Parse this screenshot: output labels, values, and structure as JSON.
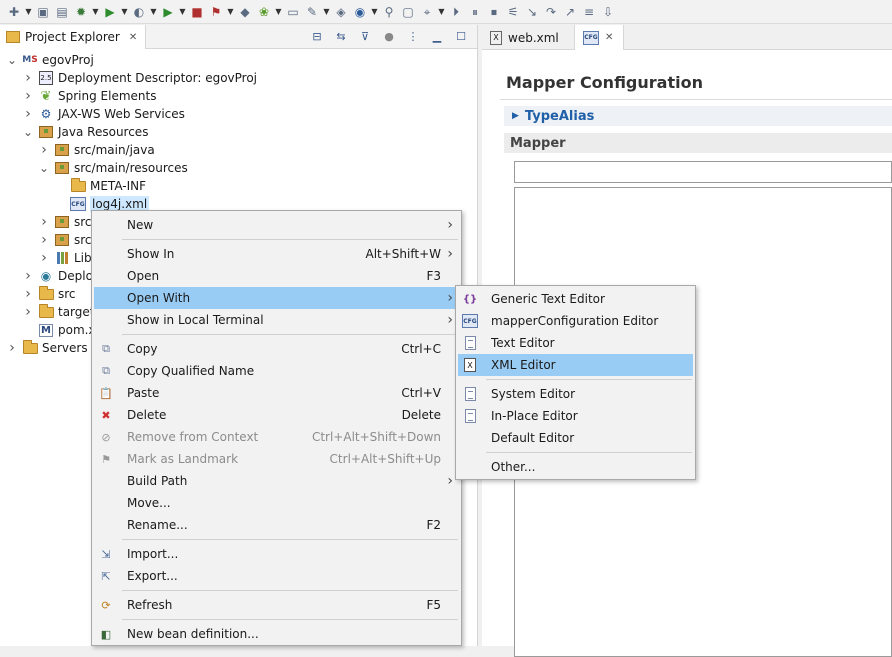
{
  "toolbar": {
    "icons": [
      "new-icon",
      "save-icon",
      "save-all-icon",
      "debug-icon",
      "run-icon",
      "coverage-icon",
      "run-server-icon",
      "stop-icon",
      "profile-icon",
      "new-java-icon",
      "new-spring-icon",
      "open-folder-icon",
      "open-task-icon",
      "open-type-icon",
      "globe-icon",
      "search-icon",
      "console-icon",
      "pin-icon",
      "resume-icon",
      "suspend-icon",
      "terminate-icon",
      "disconnect-icon",
      "step-into-icon",
      "step-over-icon",
      "step-return-icon",
      "drop-frame-icon",
      "next-annotation-icon"
    ]
  },
  "explorer": {
    "tab_label": "Project Explorer",
    "tree": [
      {
        "label": "egovProj",
        "indent": 0,
        "twisty": "open",
        "icon": "maven-project-icon"
      },
      {
        "label": "Deployment Descriptor: egovProj",
        "indent": 1,
        "twisty": "closed",
        "icon": "deployment-descriptor-icon"
      },
      {
        "label": "Spring Elements",
        "indent": 1,
        "twisty": "closed",
        "icon": "spring-leaf-icon"
      },
      {
        "label": "JAX-WS Web Services",
        "indent": 1,
        "twisty": "closed",
        "icon": "web-services-icon"
      },
      {
        "label": "Java Resources",
        "indent": 1,
        "twisty": "open",
        "icon": "java-resources-icon"
      },
      {
        "label": "src/main/java",
        "indent": 2,
        "twisty": "closed",
        "icon": "source-folder-icon"
      },
      {
        "label": "src/main/resources",
        "indent": 2,
        "twisty": "open",
        "icon": "source-folder-icon"
      },
      {
        "label": "META-INF",
        "indent": 3,
        "twisty": "none",
        "icon": "folder-icon"
      },
      {
        "label": "log4j.xml",
        "indent": 3,
        "twisty": "none",
        "icon": "cfg-file-icon",
        "selected": true
      },
      {
        "label": "src/",
        "indent": 2,
        "twisty": "closed",
        "icon": "source-folder-icon"
      },
      {
        "label": "src/",
        "indent": 2,
        "twisty": "closed",
        "icon": "source-folder-icon"
      },
      {
        "label": "Libr",
        "indent": 2,
        "twisty": "closed",
        "icon": "library-icon"
      },
      {
        "label": "Deplo",
        "indent": 1,
        "twisty": "closed",
        "icon": "deployed-resources-icon"
      },
      {
        "label": "src",
        "indent": 1,
        "twisty": "closed",
        "icon": "folder-icon"
      },
      {
        "label": "target",
        "indent": 1,
        "twisty": "closed",
        "icon": "folder-icon"
      },
      {
        "label": "pom.x",
        "indent": 1,
        "twisty": "none",
        "icon": "maven-pom-icon"
      },
      {
        "label": "Servers",
        "indent": 0,
        "twisty": "closed",
        "icon": "folder-icon"
      }
    ]
  },
  "editor": {
    "tabs": [
      {
        "label": "web.xml",
        "icon": "xml-file-icon"
      },
      {
        "label": "",
        "icon": "cfg-file-icon"
      }
    ],
    "form_title": "Mapper Configuration",
    "section_typealias": "TypeAlias",
    "section_mapper": "Mapper"
  },
  "context_menu": {
    "items": [
      {
        "label": "New",
        "shortcut": "",
        "submenu": true,
        "icon": "",
        "disabled": false
      },
      {
        "sep": true
      },
      {
        "label": "Show In",
        "shortcut": "Alt+Shift+W",
        "submenu": true,
        "icon": "",
        "disabled": false
      },
      {
        "label": "Open",
        "shortcut": "F3",
        "submenu": false,
        "icon": "",
        "disabled": false
      },
      {
        "label": "Open With",
        "shortcut": "",
        "submenu": true,
        "icon": "",
        "disabled": false,
        "highlighted": true
      },
      {
        "label": "Show in Local Terminal",
        "shortcut": "",
        "submenu": true,
        "icon": "",
        "disabled": false
      },
      {
        "sep": true
      },
      {
        "label": "Copy",
        "shortcut": "Ctrl+C",
        "submenu": false,
        "icon": "copy-icon",
        "disabled": false
      },
      {
        "label": "Copy Qualified Name",
        "shortcut": "",
        "submenu": false,
        "icon": "copy-qualified-icon",
        "disabled": false
      },
      {
        "label": "Paste",
        "shortcut": "Ctrl+V",
        "submenu": false,
        "icon": "paste-icon",
        "disabled": false
      },
      {
        "label": "Delete",
        "shortcut": "Delete",
        "submenu": false,
        "icon": "delete-icon",
        "disabled": false
      },
      {
        "label": "Remove from Context",
        "shortcut": "Ctrl+Alt+Shift+Down",
        "submenu": false,
        "icon": "remove-context-icon",
        "disabled": true
      },
      {
        "label": "Mark as Landmark",
        "shortcut": "Ctrl+Alt+Shift+Up",
        "submenu": false,
        "icon": "landmark-icon",
        "disabled": true
      },
      {
        "label": "Build Path",
        "shortcut": "",
        "submenu": true,
        "icon": "",
        "disabled": false
      },
      {
        "label": "Move...",
        "shortcut": "",
        "submenu": false,
        "icon": "",
        "disabled": false
      },
      {
        "label": "Rename...",
        "shortcut": "F2",
        "submenu": false,
        "icon": "",
        "disabled": false
      },
      {
        "sep": true
      },
      {
        "label": "Import...",
        "shortcut": "",
        "submenu": false,
        "icon": "import-icon",
        "disabled": false
      },
      {
        "label": "Export...",
        "shortcut": "",
        "submenu": false,
        "icon": "export-icon",
        "disabled": false
      },
      {
        "sep": true
      },
      {
        "label": "Refresh",
        "shortcut": "F5",
        "submenu": false,
        "icon": "refresh-icon",
        "disabled": false
      },
      {
        "sep": true
      },
      {
        "label": "New bean definition...",
        "shortcut": "",
        "submenu": false,
        "icon": "bean-definition-icon",
        "disabled": false
      }
    ]
  },
  "open_with_menu": {
    "items": [
      {
        "label": "Generic Text Editor",
        "icon": "generic-editor-icon"
      },
      {
        "label": "mapperConfiguration Editor",
        "icon": "cfg-file-icon"
      },
      {
        "label": "Text Editor",
        "icon": "text-file-icon"
      },
      {
        "label": "XML Editor",
        "icon": "xml-editor-icon",
        "highlighted": true
      },
      {
        "sep": true
      },
      {
        "label": "System Editor",
        "icon": "text-file-icon"
      },
      {
        "label": "In-Place Editor",
        "icon": "text-file-icon"
      },
      {
        "label": "Default Editor",
        "icon": ""
      },
      {
        "sep": true
      },
      {
        "label": "Other...",
        "icon": ""
      }
    ]
  },
  "colors": {
    "menu_highlight": "#99ccf5",
    "selection": "#cde8ff",
    "section_title": "#2060a8"
  }
}
